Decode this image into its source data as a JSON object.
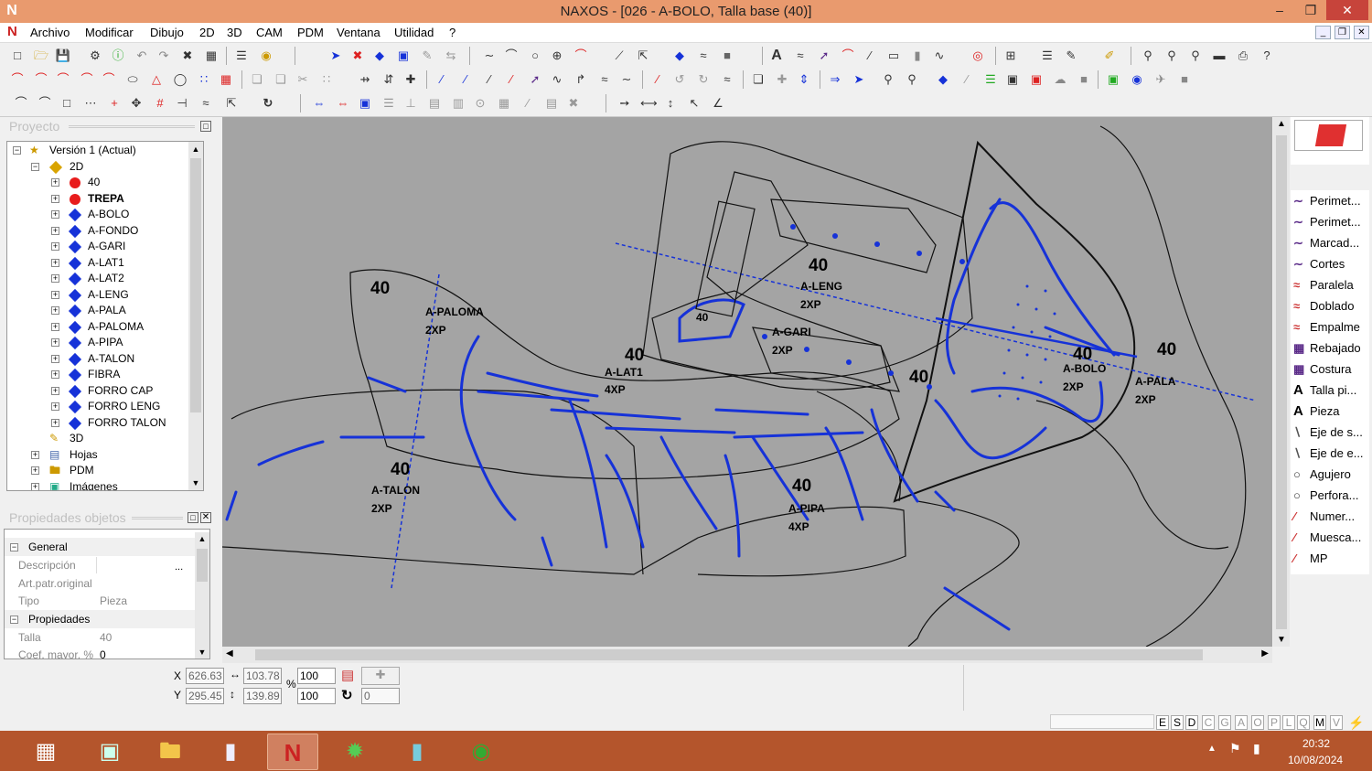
{
  "window": {
    "title": "NAXOS - [026 - A-BOLO, Talla base (40)]",
    "logo_icon": "naxos-logo-icon",
    "accent": "#e99a6e",
    "close_color": "#c7443b"
  },
  "menu": [
    "Archivo",
    "Modificar",
    "Dibujo",
    "2D",
    "3D",
    "CAM",
    "PDM",
    "Ventana",
    "Utilidad",
    "?"
  ],
  "project_panel": {
    "title": "Proyecto",
    "tree": [
      {
        "label": "Versión 1 (Actual)",
        "icon": "version-icon"
      },
      {
        "label": "2D",
        "icon": "layer-2d-icon"
      },
      {
        "label": "40",
        "icon": "red-dot"
      },
      {
        "label": "TREPA",
        "icon": "red-dot",
        "bold": true
      },
      {
        "label": "A-BOLO",
        "icon": "blue-diamond"
      },
      {
        "label": "A-FONDO",
        "icon": "blue-diamond"
      },
      {
        "label": "A-GARI",
        "icon": "blue-diamond"
      },
      {
        "label": "A-LAT1",
        "icon": "blue-diamond"
      },
      {
        "label": "A-LAT2",
        "icon": "blue-diamond"
      },
      {
        "label": "A-LENG",
        "icon": "blue-diamond"
      },
      {
        "label": "A-PALA",
        "icon": "blue-diamond"
      },
      {
        "label": "A-PALOMA",
        "icon": "blue-diamond"
      },
      {
        "label": "A-PIPA",
        "icon": "blue-diamond"
      },
      {
        "label": "A-TALON",
        "icon": "blue-diamond"
      },
      {
        "label": "FIBRA",
        "icon": "blue-diamond"
      },
      {
        "label": "FORRO CAP",
        "icon": "blue-diamond"
      },
      {
        "label": "FORRO LENG",
        "icon": "blue-diamond"
      },
      {
        "label": "FORRO TALON",
        "icon": "blue-diamond"
      },
      {
        "label": "3D",
        "icon": "layer-3d-icon"
      },
      {
        "label": "Hojas",
        "icon": "sheets-icon"
      },
      {
        "label": "PDM",
        "icon": "folder-icon"
      },
      {
        "label": "Imágenes",
        "icon": "images-icon"
      }
    ]
  },
  "props_panel": {
    "title": "Propiedades objetos",
    "groups": [
      {
        "name": "General"
      },
      {
        "name": "Propiedades"
      }
    ],
    "rows": [
      {
        "key": "Descripción",
        "value": "",
        "btn": "..."
      },
      {
        "key": "Art.patr.original",
        "value": ""
      },
      {
        "key": "Tipo",
        "value": "Pieza"
      },
      {
        "key": "Talla",
        "value": "40"
      },
      {
        "key": "Coef. mayor. %",
        "value": "0"
      }
    ]
  },
  "canvas_labels": [
    {
      "size": "40",
      "name": "A-PALOMA",
      "qty": "2XP"
    },
    {
      "size": "40",
      "name": "A-LAT1",
      "qty": "4XP"
    },
    {
      "size": "40",
      "name": "A-LENG",
      "qty": "2XP"
    },
    {
      "size": "40",
      "name": "A-GARI",
      "qty": "2XP"
    },
    {
      "size": "40",
      "name": "A-BOLO",
      "qty": "2XP"
    },
    {
      "size": "40",
      "name": "A-PALA",
      "qty": "2XP"
    },
    {
      "size": "40",
      "name": "A-TALON",
      "qty": "2XP"
    },
    {
      "size": "40",
      "name": "A-PIPA",
      "qty": "4XP"
    },
    {
      "size": "40"
    },
    {
      "size": "40"
    }
  ],
  "right_tools": [
    {
      "label": "Perimet...",
      "icon": "perimeter-icon"
    },
    {
      "label": "Perimet...",
      "icon": "perimeter-icon"
    },
    {
      "label": "Marcad...",
      "icon": "marker-icon"
    },
    {
      "label": "Cortes",
      "icon": "cuts-icon"
    },
    {
      "label": "Paralela",
      "icon": "parallel-icon"
    },
    {
      "label": "Doblado",
      "icon": "fold-icon"
    },
    {
      "label": "Empalme",
      "icon": "splice-icon"
    },
    {
      "label": "Rebajado",
      "icon": "skive-icon"
    },
    {
      "label": "Costura",
      "icon": "seam-icon"
    },
    {
      "label": "Talla pi...",
      "icon": "text-size-icon"
    },
    {
      "label": "Pieza",
      "icon": "text-piece-icon"
    },
    {
      "label": "Eje de s...",
      "icon": "axis-icon"
    },
    {
      "label": "Eje de e...",
      "icon": "axis-icon"
    },
    {
      "label": "Agujero",
      "icon": "hole-icon"
    },
    {
      "label": "Perfora...",
      "icon": "perforation-icon"
    },
    {
      "label": "Numer...",
      "icon": "number-icon"
    },
    {
      "label": "Muesca...",
      "icon": "notch-icon"
    },
    {
      "label": "MP",
      "icon": "mp-icon"
    }
  ],
  "coords": {
    "x_label": "X",
    "y_label": "Y",
    "x": "626.63",
    "y": "295.45",
    "dx": "103.78",
    "dy": "139.89",
    "scale_x": "100",
    "scale_y": "100",
    "percent": "%",
    "rotation": "0"
  },
  "status_letters": [
    "E",
    "S",
    "D",
    "C",
    "G",
    "A",
    "O",
    "P",
    "L",
    "Q",
    "M",
    "V"
  ],
  "clock": {
    "time": "20:32",
    "date": "10/08/2024"
  }
}
